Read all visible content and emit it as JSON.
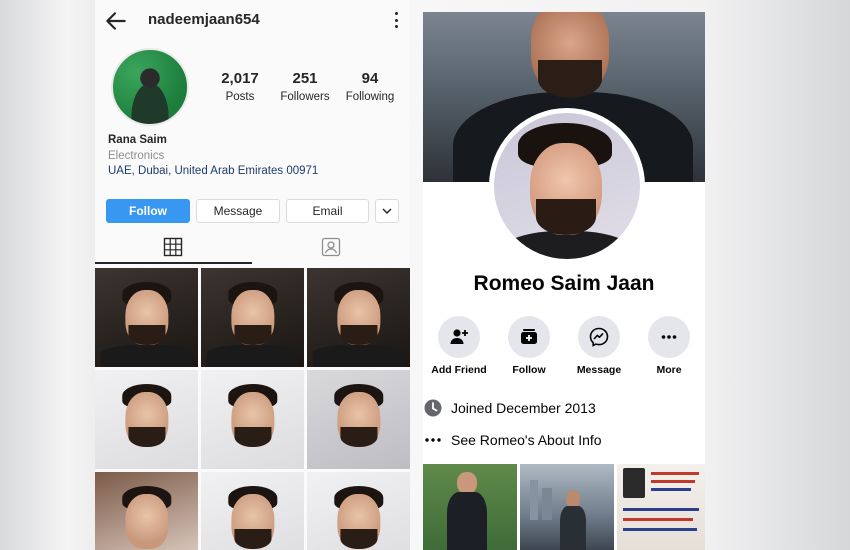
{
  "instagram": {
    "username": "nadeemjaan654",
    "stats": [
      {
        "value": "2,017",
        "label": "Posts"
      },
      {
        "value": "251",
        "label": "Followers"
      },
      {
        "value": "94",
        "label": "Following"
      }
    ],
    "profile_name": "Rana Saim",
    "category": "Electronics",
    "location": "UAE, Dubai, United Arab Emirates 00971",
    "buttons": {
      "follow": "Follow",
      "message": "Message",
      "email": "Email"
    },
    "icons": [
      "back-arrow-icon",
      "more-vertical-icon",
      "grid-icon",
      "tagged-icon",
      "chevron-down-icon"
    ],
    "colors": {
      "follow_button": "#3897f0",
      "location_text": "#1e3a6e"
    }
  },
  "facebook": {
    "name": "Romeo Saim Jaan",
    "actions": [
      {
        "label": "Add Friend",
        "icon": "add-friend-icon"
      },
      {
        "label": "Follow",
        "icon": "follow-icon"
      },
      {
        "label": "Message",
        "icon": "messenger-icon"
      },
      {
        "label": "More",
        "icon": "more-horizontal-icon"
      }
    ],
    "joined": "Joined December 2013",
    "about": "See Romeo's About Info"
  }
}
